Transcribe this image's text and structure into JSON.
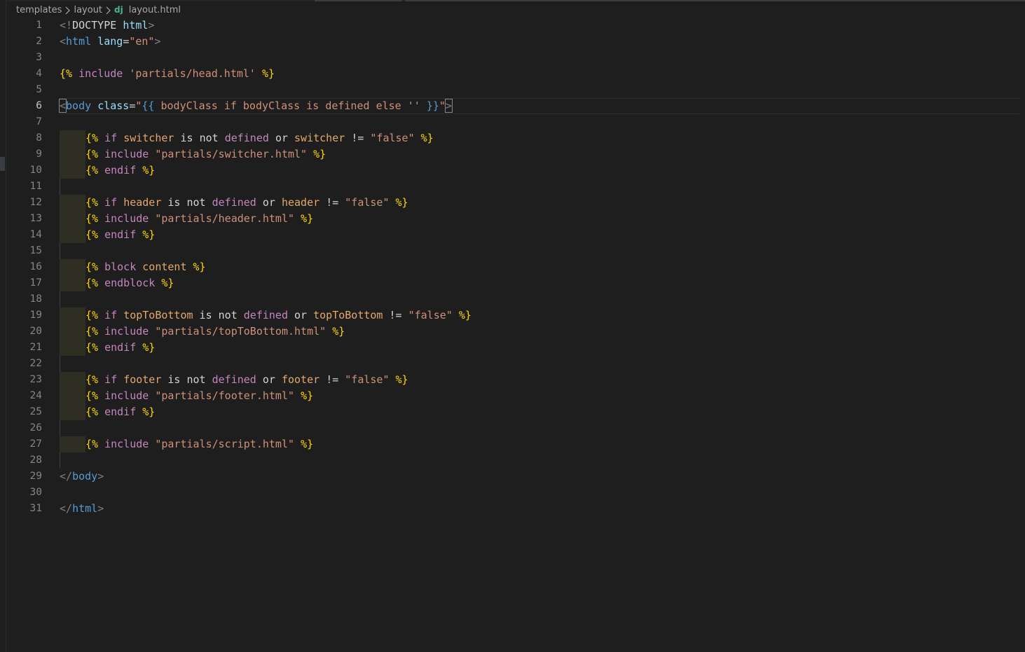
{
  "breadcrumb": {
    "items": [
      "templates",
      "layout"
    ],
    "file_icon": "dj",
    "file_name": "layout.html"
  },
  "editor": {
    "active_line": 6,
    "lines": [
      "<!DOCTYPE html>",
      "<html lang=\"en\">",
      "",
      "{% include 'partials/head.html' %}",
      "",
      "<body class=\"{{ bodyClass if bodyClass is defined else '' }}\">",
      "",
      "    {% if switcher is not defined or switcher != \"false\" %}",
      "    {% include \"partials/switcher.html\" %}",
      "    {% endif %}",
      "",
      "    {% if header is not defined or header != \"false\" %}",
      "    {% include \"partials/header.html\" %}",
      "    {% endif %}",
      "",
      "    {% block content %}",
      "    {% endblock %}",
      "",
      "    {% if topToBottom is not defined or topToBottom != \"false\" %}",
      "    {% include \"partials/topToBottom.html\" %}",
      "    {% endif %}",
      "",
      "    {% if footer is not defined or footer != \"false\" %}",
      "    {% include \"partials/footer.html\" %}",
      "    {% endif %}",
      "",
      "    {% include \"partials/script.html\" %}",
      "",
      "</body>",
      "",
      "</html>"
    ]
  },
  "colors": {
    "background": "#1e1e1e",
    "line_number": "#858585",
    "tag": "#569cd6",
    "string": "#ce9178",
    "jinja_delimiter": "#ffd700",
    "keyword": "#c586c0",
    "django_icon": "#44b78b"
  }
}
